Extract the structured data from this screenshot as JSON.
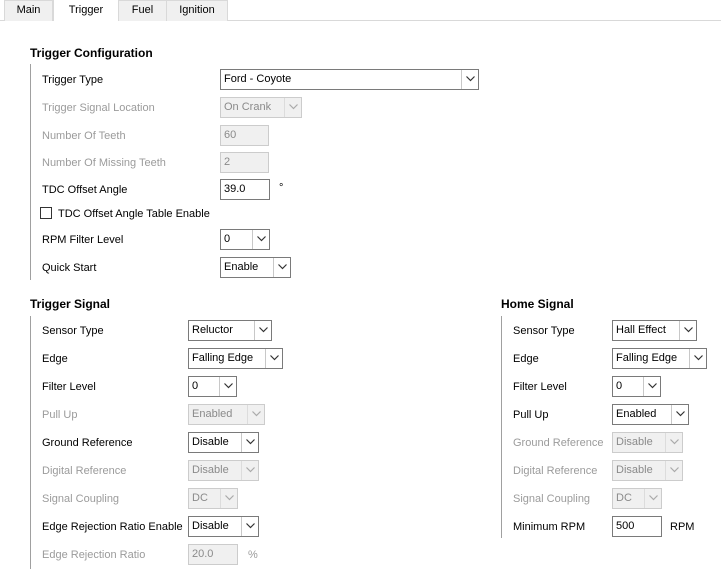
{
  "tabs": [
    {
      "label": "Main"
    },
    {
      "label": "Trigger"
    },
    {
      "label": "Fuel"
    },
    {
      "label": "Ignition"
    }
  ],
  "trigger_config": {
    "title": "Trigger Configuration",
    "trigger_type_label": "Trigger Type",
    "trigger_type_value": "Ford - Coyote",
    "signal_location_label": "Trigger Signal Location",
    "signal_location_value": "On Crank",
    "num_teeth_label": "Number Of Teeth",
    "num_teeth_value": "60",
    "missing_teeth_label": "Number Of Missing Teeth",
    "missing_teeth_value": "2",
    "tdc_offset_label": "TDC Offset Angle",
    "tdc_offset_value": "39.0",
    "tdc_offset_unit": "°",
    "tdc_table_label": "TDC Offset Angle Table Enable",
    "rpm_filter_label": "RPM Filter Level",
    "rpm_filter_value": "0",
    "quick_start_label": "Quick Start",
    "quick_start_value": "Enable"
  },
  "trigger_signal": {
    "title": "Trigger Signal",
    "sensor_type_label": "Sensor Type",
    "sensor_type_value": "Reluctor",
    "edge_label": "Edge",
    "edge_value": "Falling Edge",
    "filter_level_label": "Filter Level",
    "filter_level_value": "0",
    "pull_up_label": "Pull Up",
    "pull_up_value": "Enabled",
    "ground_ref_label": "Ground Reference",
    "ground_ref_value": "Disable",
    "digital_ref_label": "Digital Reference",
    "digital_ref_value": "Disable",
    "coupling_label": "Signal Coupling",
    "coupling_value": "DC",
    "edge_rej_enable_label": "Edge Rejection Ratio Enable",
    "edge_rej_enable_value": "Disable",
    "edge_rej_ratio_label": "Edge Rejection Ratio",
    "edge_rej_ratio_value": "20.0",
    "edge_rej_ratio_unit": "%"
  },
  "home_signal": {
    "title": "Home Signal",
    "sensor_type_label": "Sensor Type",
    "sensor_type_value": "Hall Effect",
    "edge_label": "Edge",
    "edge_value": "Falling Edge",
    "filter_level_label": "Filter Level",
    "filter_level_value": "0",
    "pull_up_label": "Pull Up",
    "pull_up_value": "Enabled",
    "ground_ref_label": "Ground Reference",
    "ground_ref_value": "Disable",
    "digital_ref_label": "Digital Reference",
    "digital_ref_value": "Disable",
    "coupling_label": "Signal Coupling",
    "coupling_value": "DC",
    "min_rpm_label": "Minimum RPM",
    "min_rpm_value": "500",
    "min_rpm_unit": "RPM"
  }
}
